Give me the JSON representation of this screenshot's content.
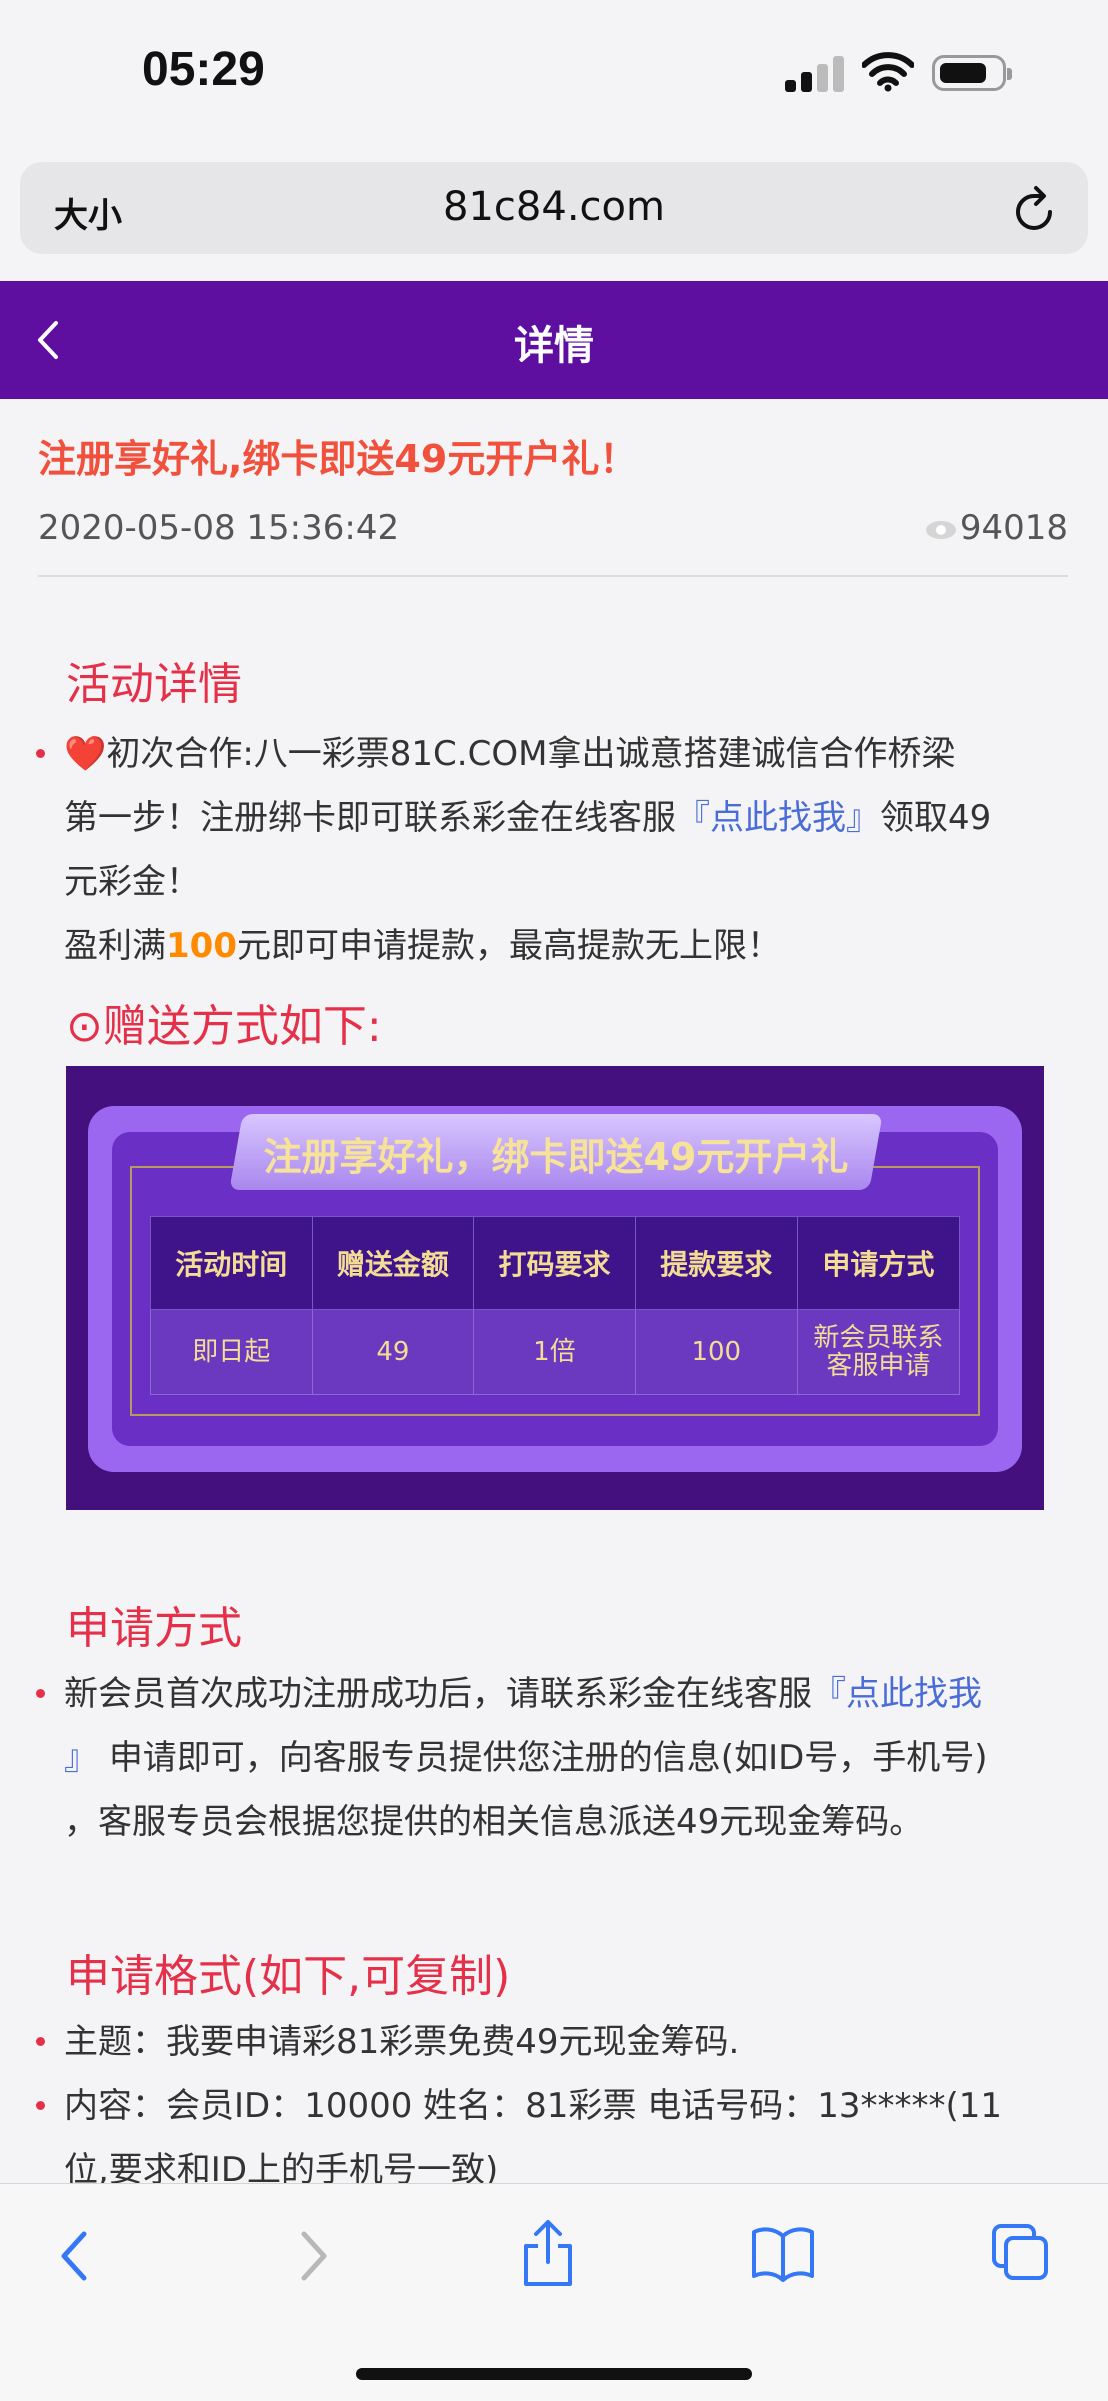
{
  "status": {
    "time": "05:29"
  },
  "browser": {
    "text_size_label": "大小",
    "url": "81c84.com"
  },
  "header": {
    "title": "详情"
  },
  "article": {
    "title": "注册享好礼,绑卡即送49元开户礼！",
    "date": "2020-05-08 15:36:42",
    "views": "94018"
  },
  "section1": {
    "heading": "活动详情",
    "line1_heart": "❤️",
    "line1": "初次合作:八一彩票81C.COM拿出诚意搭建诚信合作桥梁",
    "line2_pre": "第一步！注册绑卡即可联系彩金在线客服",
    "line2_link": "『点此找我』",
    "line2_post": "领取49",
    "line3": "元彩金！",
    "line4_pre": "盈利满",
    "line4_hl": "100",
    "line4_post": "元即可申请提款，最高提款无上限！",
    "method_heading": "⊙赠送方式如下:"
  },
  "banner": {
    "ribbon": "注册享好礼，绑卡即送49元开户礼",
    "headers": [
      "活动时间",
      "赠送金额",
      "打码要求",
      "提款要求",
      "申请方式"
    ],
    "row": [
      "即日起",
      "49",
      "1倍",
      "100",
      "新会员联系客服申请"
    ]
  },
  "section2": {
    "heading": "申请方式",
    "line1_pre": "新会员首次成功注册成功后，请联系彩金在线客服",
    "line1_link": "『点此找我",
    "line2_link": "』",
    "line2_post": "申请即可，向客服专员提供您注册的信息(如ID号，手机号)",
    "line3": "，客服专员会根据您提供的相关信息派送49元现金筹码。"
  },
  "section3": {
    "heading": "申请格式(如下,可复制)",
    "line1": "主题：我要申请彩81彩票免费49元现金筹码.",
    "line2": "内容：会员ID：10000 姓名：81彩票 电话号码：13*****(11",
    "line3": "位,要求和ID上的手机号一致)"
  },
  "colors": {
    "header": "#5f0fa0",
    "accent_red": "#e5304a",
    "link": "#4a6cd6",
    "highlight": "#ff8a00"
  }
}
